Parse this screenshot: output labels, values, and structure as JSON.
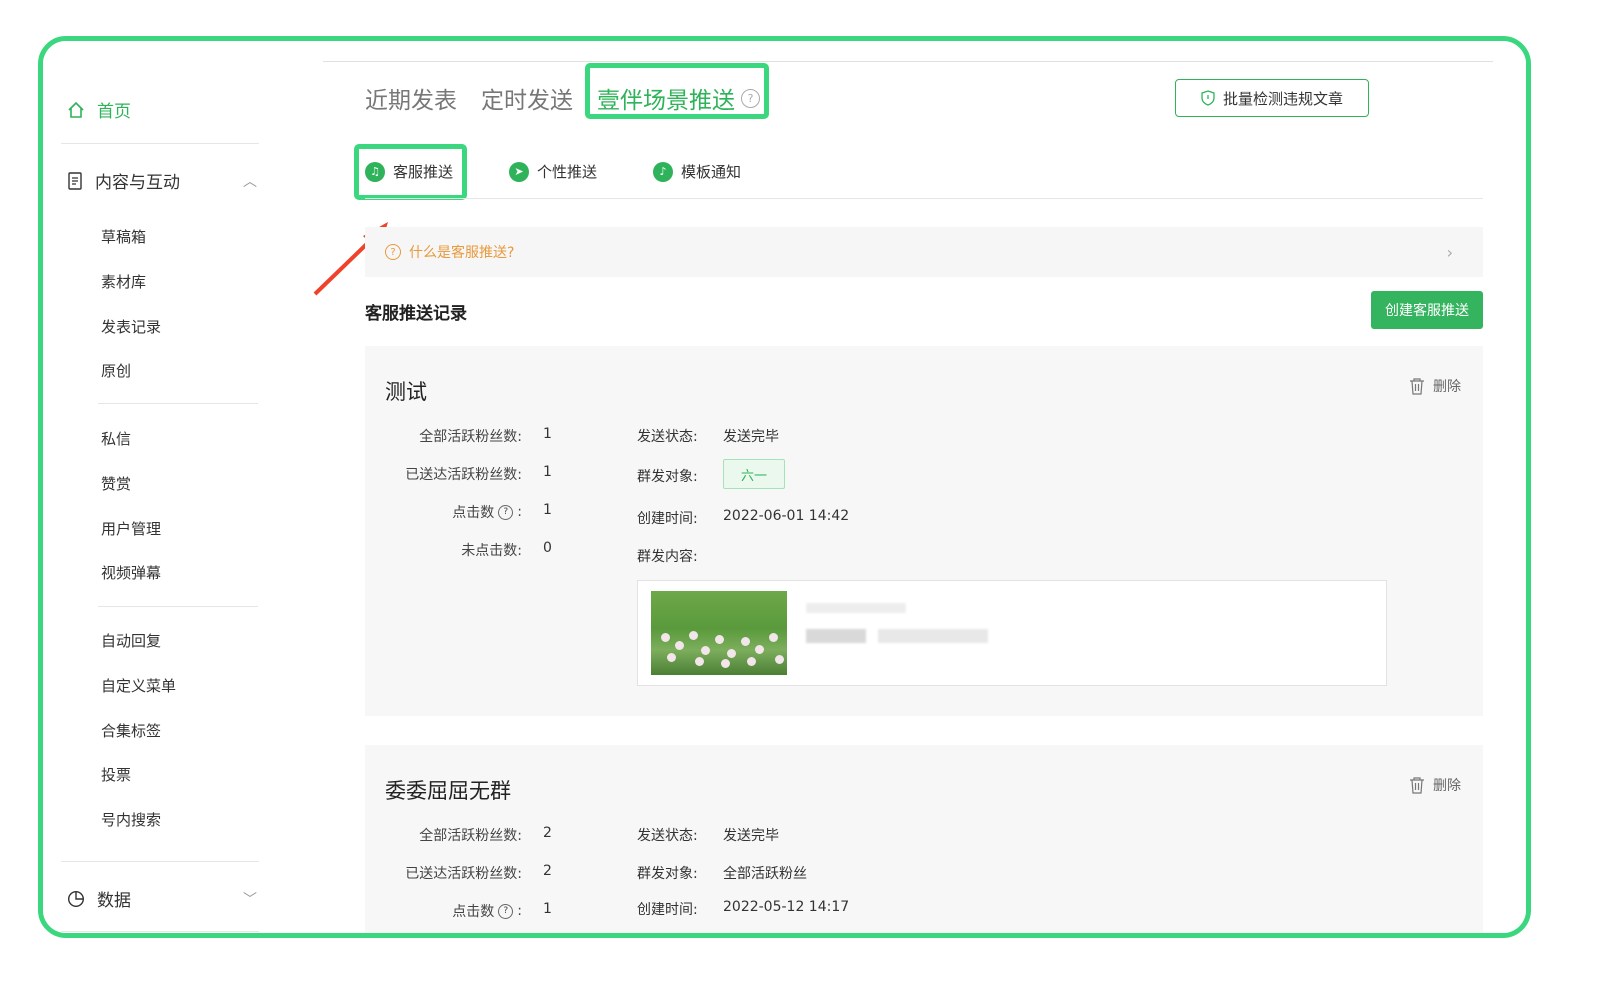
{
  "sidebar": {
    "home": "首页",
    "content_group": "内容与互动",
    "content_items": [
      "草稿箱",
      "素材库",
      "发表记录",
      "原创"
    ],
    "interact_items": [
      "私信",
      "赞赏",
      "用户管理",
      "视频弹幕"
    ],
    "feature_items": [
      "自动回复",
      "自定义菜单",
      "合集标签",
      "投票",
      "号内搜索"
    ],
    "data_group": "数据"
  },
  "top_tabs": [
    "近期发表",
    "定时发送",
    "壹伴场景推送"
  ],
  "batch_check_label": "批量检测违规文章",
  "sub_tabs": [
    "客服推送",
    "个性推送",
    "模板通知"
  ],
  "info_text": "什么是客服推送?",
  "records_title": "客服推送记录",
  "create_button": "创建客服推送",
  "delete_label": "删除",
  "labels": {
    "all_fans": "全部活跃粉丝数:",
    "delivered_fans": "已送达活跃粉丝数:",
    "clicks": "点击数",
    "unclicked": "未点击数:",
    "send_status": "发送状态:",
    "target": "群发对象:",
    "created": "创建时间:",
    "content": "群发内容:",
    "colon": ":"
  },
  "records": [
    {
      "title": "测试",
      "all_fans": "1",
      "delivered_fans": "1",
      "clicks": "1",
      "unclicked": "0",
      "send_status": "发送完毕",
      "target": "六一",
      "created": "2022-06-01 14:42"
    },
    {
      "title": "委委屈屈无群",
      "all_fans": "2",
      "delivered_fans": "2",
      "clicks": "1",
      "send_status": "发送完毕",
      "target": "全部活跃粉丝",
      "created": "2022-05-12 14:17"
    }
  ],
  "colors": {
    "accent": "#2fb35a",
    "highlight": "#3ad77e",
    "annotation_arrow": "#f0412a"
  }
}
